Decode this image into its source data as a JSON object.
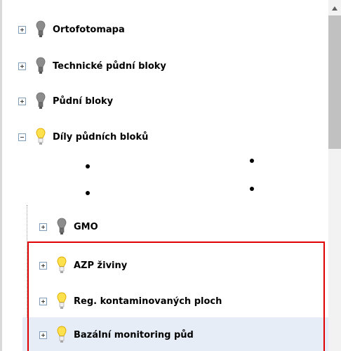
{
  "tree": {
    "items": [
      {
        "label": "Ortofotomapa",
        "icon": "lightbulb-gray-icon",
        "expander": "plus"
      },
      {
        "label": "Technické půdní bloky",
        "icon": "lightbulb-gray-icon",
        "expander": "plus"
      },
      {
        "label": "Půdní bloky",
        "icon": "lightbulb-gray-icon",
        "expander": "plus"
      },
      {
        "label": "Díly půdních bloků",
        "icon": "lightbulb-yellow-icon",
        "expander": "minus"
      },
      {
        "label": "GMO",
        "icon": "lightbulb-gray-icon",
        "expander": "plus"
      },
      {
        "label": "AZP živiny",
        "icon": "lightbulb-yellow-icon",
        "expander": "plus"
      },
      {
        "label": "Reg. kontaminovaných ploch",
        "icon": "lightbulb-yellow-icon",
        "expander": "plus"
      },
      {
        "label": "Bazální monitoring půd",
        "icon": "lightbulb-yellow-icon",
        "expander": "plus",
        "selected": true
      }
    ]
  },
  "colors": {
    "highlight_border": "#e00000",
    "selected_row": "#e6edf7",
    "bulb_on": "#ffe14d",
    "bulb_off": "#8c8c8c"
  }
}
